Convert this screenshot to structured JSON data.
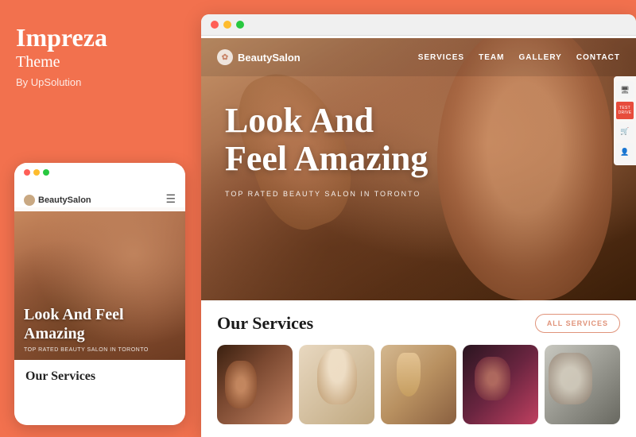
{
  "left_panel": {
    "brand_name_bold": "Impreza",
    "brand_name_regular": "Theme",
    "brand_by": "By UpSolution"
  },
  "mobile_mockup": {
    "dots": [
      "red",
      "yellow",
      "green"
    ],
    "logo": "BeautySalon",
    "hero_title": "Look And Feel Amazing",
    "hero_subtitle": "TOP RATED BEAUTY SALON IN TORONTO",
    "services_title": "Our Services"
  },
  "browser": {
    "dots": [
      "red",
      "yellow",
      "green"
    ],
    "nav": {
      "logo": "BeautySalon",
      "links": [
        "SERVICES",
        "TEAM",
        "GALLERY",
        "CONTACT"
      ]
    },
    "hero": {
      "title_line1": "Look And",
      "title_line2": "Feel Amazing",
      "subtitle": "TOP RATED BEAUTY SALON IN TORONTO"
    },
    "sidebar_icons": {
      "monitor_icon": "🖥",
      "test_label": "TEST DRIVE",
      "cart_icon": "🛒",
      "user_icon": "👤"
    },
    "services": {
      "title": "Our Services",
      "all_services_button": "ALL SERVICES",
      "cards": [
        {
          "id": 1,
          "alt": "hands service"
        },
        {
          "id": 2,
          "alt": "facial treatment"
        },
        {
          "id": 3,
          "alt": "beauty products"
        },
        {
          "id": 4,
          "alt": "eye makeup"
        },
        {
          "id": 5,
          "alt": "lash service"
        }
      ]
    }
  }
}
